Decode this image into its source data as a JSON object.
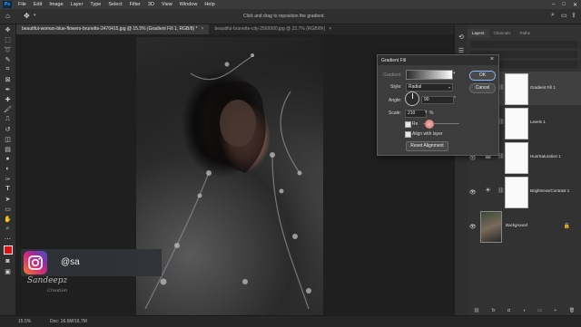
{
  "menubar": {
    "logo": "Ps",
    "items": [
      "File",
      "Edit",
      "Image",
      "Layer",
      "Type",
      "Select",
      "Filter",
      "3D",
      "View",
      "Window",
      "Help"
    ],
    "window_controls": [
      "–",
      "□",
      "✕"
    ]
  },
  "options_bar": {
    "hint": "Click and drag to reposition the gradient."
  },
  "tabs": [
    {
      "label": "beautiful-woman-blue-flowers-brunette-2470415.jpg @ 15.5% (Gradient Fill 1, RGB/8) *",
      "close": "×"
    },
    {
      "label": "beautiful-brunette-city-2569900.jpg @ 22.7% (RGB/8#)",
      "close": "×"
    }
  ],
  "status_bar": {
    "zoom": "15.5%",
    "doc": "Doc: 16.6M/16.7M"
  },
  "layers_panel": {
    "tabs": [
      "Layers",
      "Channels",
      "Paths"
    ],
    "layers": [
      {
        "name": "Gradient Fill 1"
      },
      {
        "name": "Levels 1"
      },
      {
        "name": "Hue/Saturation 1"
      },
      {
        "name": "Brightness/Contrast 1"
      },
      {
        "name": "Background"
      }
    ]
  },
  "gradient_dialog": {
    "title": "Gradient Fill",
    "gradient_label": "Gradient:",
    "style_label": "Style:",
    "style_value": "Radial",
    "angle_label": "Angle:",
    "angle_value": "90",
    "scale_label": "Scale:",
    "scale_value": "210",
    "scale_unit": "%",
    "reverse_label": "Re",
    "align_label": "Align with layer",
    "reset_label": "Reset Alignment",
    "ok_label": "OK",
    "cancel_label": "Cancel"
  },
  "overlay": {
    "handle": "@sa",
    "signature": "Sandeepz",
    "signature_sub": "Creation"
  }
}
